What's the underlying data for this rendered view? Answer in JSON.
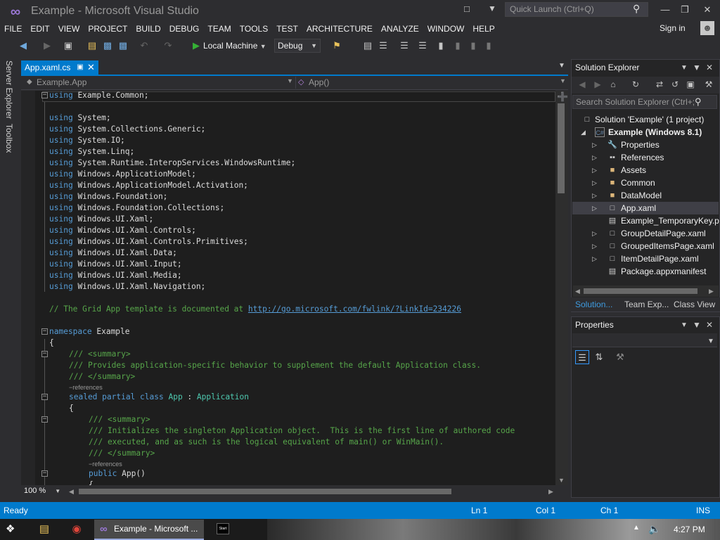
{
  "window": {
    "title": "Example - Microsoft Visual Studio",
    "quick_launch_placeholder": "Quick Launch (Ctrl+Q)"
  },
  "menu": [
    "FILE",
    "EDIT",
    "VIEW",
    "PROJECT",
    "BUILD",
    "DEBUG",
    "TEAM",
    "TOOLS",
    "TEST",
    "ARCHITECTURE",
    "ANALYZE",
    "WINDOW",
    "HELP"
  ],
  "account": {
    "sign_in": "Sign in"
  },
  "toolbar": {
    "run_target": "Local Machine",
    "configuration": "Debug"
  },
  "side_tabs": {
    "server_explorer": "Server Explorer",
    "toolbox": "Toolbox"
  },
  "document": {
    "tab": "App.xaml.cs",
    "nav_left": "Example.App",
    "nav_right": "App()"
  },
  "code": {
    "l1": "Example.Common;",
    "usings": [
      "System;",
      "System.Collections.Generic;",
      "System.IO;",
      "System.Linq;",
      "System.Runtime.InteropServices.WindowsRuntime;",
      "Windows.ApplicationModel;",
      "Windows.ApplicationModel.Activation;",
      "Windows.Foundation;",
      "Windows.Foundation.Collections;",
      "Windows.UI.Xaml;",
      "Windows.UI.Xaml.Controls;",
      "Windows.UI.Xaml.Controls.Primitives;",
      "Windows.UI.Xaml.Data;",
      "Windows.UI.Xaml.Input;",
      "Windows.UI.Xaml.Media;",
      "Windows.UI.Xaml.Navigation;"
    ],
    "kw_using": "using",
    "template_comment": "// The Grid App template is documented at ",
    "template_link": "http://go.microsoft.com/fwlink/?LinkId=234226",
    "kw_namespace": "namespace",
    "namespace_name": " Example",
    "brace_open": "{",
    "summary_open": "/// <summary>",
    "summary_text": "/// Provides application-specific behavior to supplement the default Application class.",
    "summary_close": "/// </summary>",
    "refs": "−references",
    "kw_sealed_partial_class": "sealed partial class",
    "class_name": "App",
    "colon": " : ",
    "base_class": "Application",
    "ctor_summary_open": "/// <summary>",
    "ctor_summary_1": "/// Initializes the singleton Application object.  This is the first line of authored code",
    "ctor_summary_2": "/// executed, and as such is the logical equivalent of main() or WinMain().",
    "ctor_summary_close": "/// </summary>",
    "kw_public": "public",
    "ctor_name": " App()"
  },
  "editor": {
    "zoom": "100 %"
  },
  "solution_explorer": {
    "title": "Solution Explorer",
    "search_placeholder": "Search Solution Explorer (Ctrl+;",
    "items": [
      {
        "label": "Solution 'Example' (1 project)"
      },
      {
        "label": "Example (Windows 8.1)"
      },
      {
        "label": "Properties"
      },
      {
        "label": "References"
      },
      {
        "label": "Assets"
      },
      {
        "label": "Common"
      },
      {
        "label": "DataModel"
      },
      {
        "label": "App.xaml"
      },
      {
        "label": "Example_TemporaryKey.p"
      },
      {
        "label": "GroupDetailPage.xaml"
      },
      {
        "label": "GroupedItemsPage.xaml"
      },
      {
        "label": "ItemDetailPage.xaml"
      },
      {
        "label": "Package.appxmanifest"
      }
    ],
    "tabs": [
      "Solution...",
      "Team Exp...",
      "Class View"
    ]
  },
  "properties": {
    "title": "Properties"
  },
  "status": {
    "ready": "Ready",
    "ln": "Ln 1",
    "col": "Col 1",
    "ch": "Ch 1",
    "ins": "INS"
  },
  "taskbar": {
    "vs_task": "Example - Microsoft ...",
    "clock": "4:27 PM",
    "start_tile": "Start"
  },
  "colors": {
    "accent": "#007acc",
    "keyword": "#569cd6",
    "comment": "#57a64a",
    "type": "#4ec9b0",
    "editor_bg": "#1e1e1e"
  }
}
